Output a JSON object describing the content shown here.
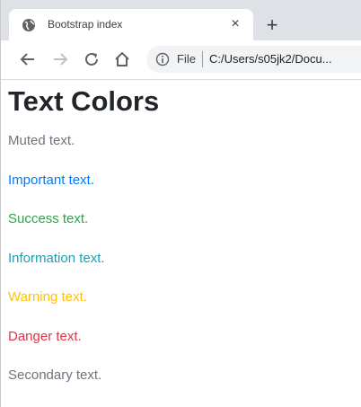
{
  "browser": {
    "tab": {
      "title": "Bootstrap index",
      "close_glyph": "×"
    },
    "new_tab_glyph": "+",
    "address_bar": {
      "scheme_label": "File",
      "url": "C:/Users/s05jk2/Docu..."
    },
    "icons": {
      "favicon": "globe-icon",
      "back": "back-arrow-icon",
      "forward": "forward-arrow-icon",
      "reload": "reload-icon",
      "home": "home-icon",
      "info": "info-icon"
    }
  },
  "page": {
    "heading": "Text Colors",
    "lines": [
      {
        "text": "Muted text.",
        "color": "#6c757d"
      },
      {
        "text": "Important text.",
        "color": "#007bff"
      },
      {
        "text": "Success text.",
        "color": "#28a745"
      },
      {
        "text": "Information text.",
        "color": "#17a2b8"
      },
      {
        "text": "Warning text.",
        "color": "#ffc107"
      },
      {
        "text": "Danger text.",
        "color": "#dc3545"
      },
      {
        "text": "Secondary text.",
        "color": "#6c757d"
      }
    ]
  }
}
